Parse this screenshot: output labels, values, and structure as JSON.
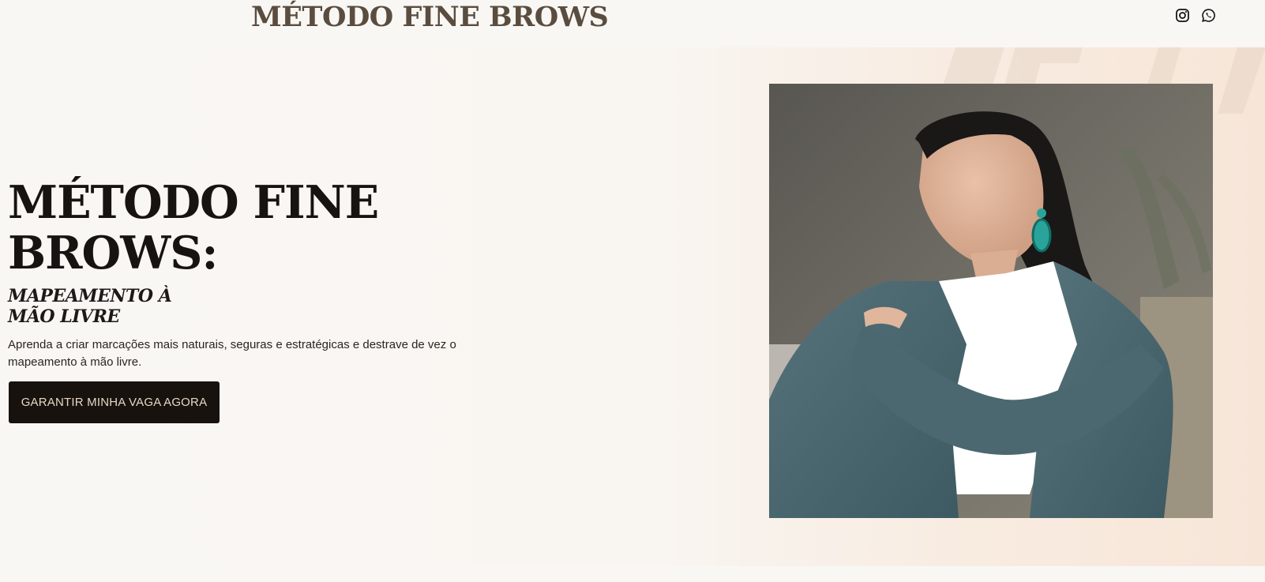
{
  "header": {
    "brand": "MÉTODO FINE BROWS",
    "social": [
      {
        "icon": "instagram-icon",
        "label": "Instagram"
      },
      {
        "icon": "whatsapp-icon",
        "label": "WhatsApp"
      }
    ]
  },
  "hero": {
    "headline_line1": "MÉTODO FINE",
    "headline_line2": "BROWS:",
    "subheadline_line1": "MAPEAMENTO À",
    "subheadline_line2": "MÃO LIVRE",
    "description_line1": "Aprenda a criar marcações mais naturais, seguras e estratégicas e destrave de vez o",
    "description_line2": "mapeamento à mão livre.",
    "cta_label": "GARANTIR MINHA VAGA AGORA",
    "image_subject": "woman-in-teal-blazer-portrait"
  },
  "colors": {
    "background": "#f9f7f4",
    "accent_peach": "#f7e6d8",
    "brand_text": "#5a4d3f",
    "cta_bg": "#17120e",
    "cta_text": "#e9d6c3"
  }
}
